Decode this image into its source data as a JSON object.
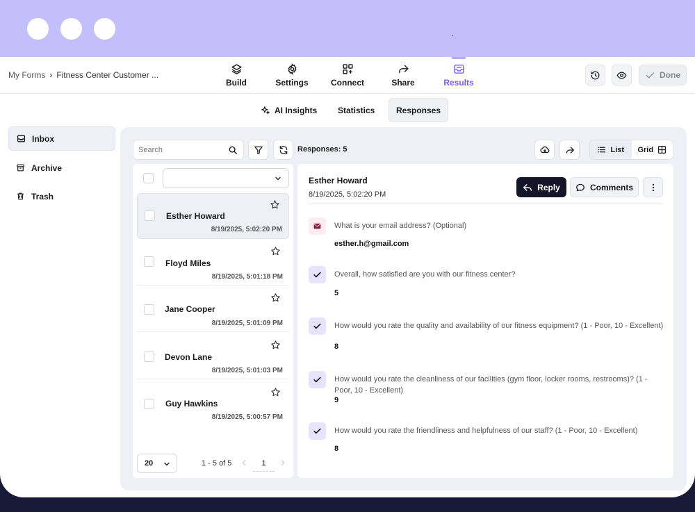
{
  "breadcrumb": {
    "root": "My Forms",
    "separator": "›",
    "current": "Fitness Center Customer ..."
  },
  "nav": [
    {
      "label": "Build",
      "icon": "layers-icon"
    },
    {
      "label": "Settings",
      "icon": "gear-icon"
    },
    {
      "label": "Connect",
      "icon": "grid-plus-icon"
    },
    {
      "label": "Share",
      "icon": "share-arrow-icon"
    },
    {
      "label": "Results",
      "icon": "inbox-icon",
      "active": true
    }
  ],
  "toolbar": {
    "done_label": "Done"
  },
  "subtabs": [
    {
      "label": "AI Insights",
      "icon": "sparkle-icon"
    },
    {
      "label": "Statistics"
    },
    {
      "label": "Responses",
      "active": true
    }
  ],
  "sidebar": {
    "items": [
      {
        "label": "Inbox",
        "icon": "inbox-icon",
        "active": true
      },
      {
        "label": "Archive",
        "icon": "archive-icon"
      },
      {
        "label": "Trash",
        "icon": "trash-icon"
      }
    ]
  },
  "search": {
    "placeholder": "Search"
  },
  "responses_label": "Responses: 5",
  "view_toggle": {
    "list": "List",
    "grid": "Grid",
    "selected": "List"
  },
  "responses": [
    {
      "name": "Esther Howard",
      "date": "8/19/2025, 5:02:20 PM",
      "selected": true
    },
    {
      "name": "Floyd Miles",
      "date": "8/19/2025, 5:01:18 PM"
    },
    {
      "name": "Jane Cooper",
      "date": "8/19/2025, 5:01:09 PM"
    },
    {
      "name": "Devon Lane",
      "date": "8/19/2025, 5:01:03 PM"
    },
    {
      "name": "Guy Hawkins",
      "date": "8/19/2025, 5:00:57 PM"
    }
  ],
  "pagination": {
    "page_size": "20",
    "range": "1 - 5 of 5",
    "page": "1"
  },
  "detail": {
    "name": "Esther Howard",
    "date": "8/19/2025, 5:02:20 PM",
    "reply_label": "Reply",
    "comments_label": "Comments",
    "questions": [
      {
        "icon": "mail-icon",
        "text": "What is your email address? (Optional)",
        "answer": "esther.h@gmail.com"
      },
      {
        "icon": "check-icon",
        "text": "Overall, how satisfied are you with our fitness center?",
        "answer": "5"
      },
      {
        "icon": "check-icon",
        "text": "How would you rate the quality and availability of our fitness equipment? (1 - Poor, 10 - Excellent)",
        "answer": "8"
      },
      {
        "icon": "check-icon",
        "text": "How would you rate the cleanliness of our facilities (gym floor, locker rooms, restrooms)? (1 - Poor, 10 - Excellent)",
        "answer": "9"
      },
      {
        "icon": "check-icon",
        "text": "How would you rate the friendliness and helpfulness of our staff? (1 - Poor, 10 - Excellent)",
        "answer": "8"
      }
    ]
  },
  "colors": {
    "accent": "#7a5cf0",
    "chrome": "#c5befd",
    "dark_button": "#141628",
    "panel": "#eef0f5"
  }
}
